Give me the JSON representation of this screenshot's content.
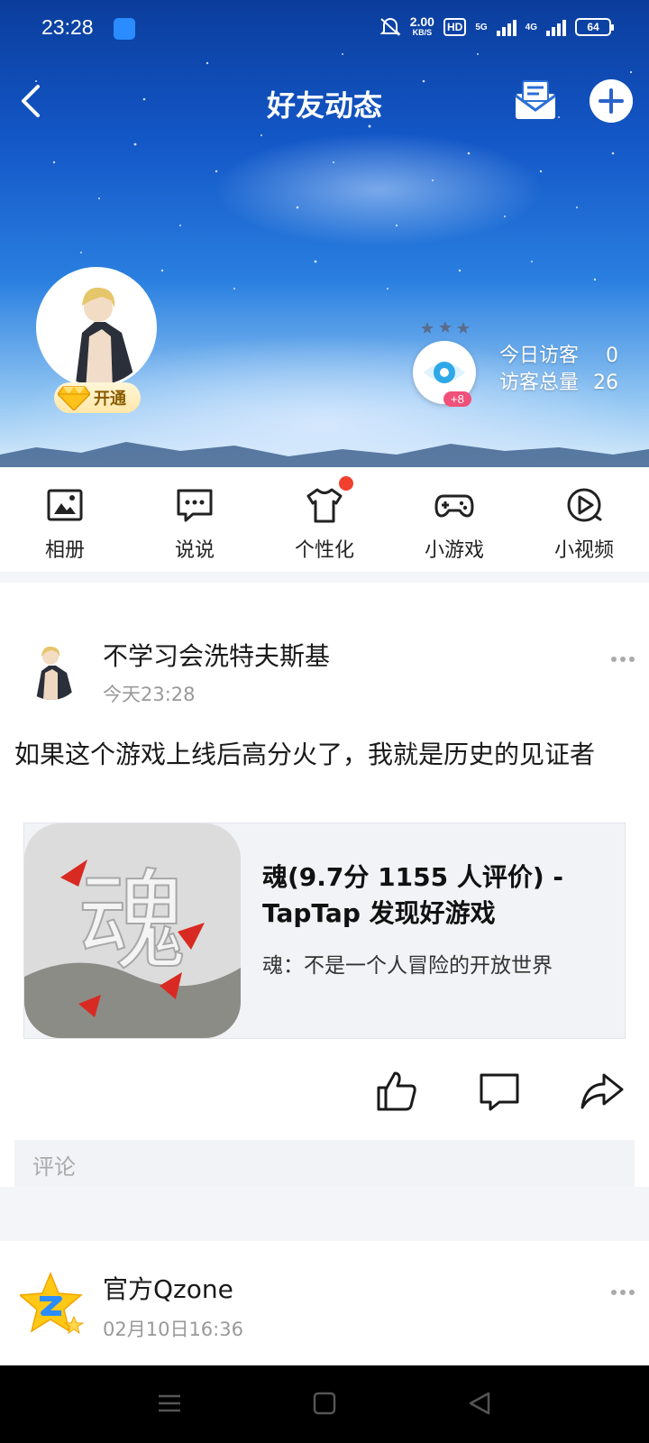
{
  "status_bar": {
    "time": "23:28",
    "net_speed": "2.00",
    "net_speed_unit": "KB/S",
    "hd_label": "HD",
    "signal_1": "5G",
    "signal_2": "4G",
    "battery": "64"
  },
  "header": {
    "title": "好友动态"
  },
  "visitors": {
    "today_label": "今日访客",
    "today_value": "0",
    "total_label": "访客总量",
    "total_value": "26",
    "plus_badge": "+8"
  },
  "vip": {
    "label": "开通"
  },
  "shortcuts": [
    {
      "label": "相册"
    },
    {
      "label": "说说"
    },
    {
      "label": "个性化"
    },
    {
      "label": "小游戏"
    },
    {
      "label": "小视频"
    }
  ],
  "post": {
    "author": "不学习会洗特夫斯基",
    "time": "今天23:28",
    "text": "如果这个游戏上线后高分火了，我就是历史的见证者",
    "card": {
      "thumb_char": "魂",
      "title": "魂(9.7分 1155 人评价) - TapTap 发现好游戏",
      "desc": "魂：不是一个人冒险的开放世界"
    },
    "comment_placeholder": "评论"
  },
  "post2": {
    "author": "官方Qzone",
    "time": "02月10日16:36"
  },
  "colors": {
    "accent_red": "#f1402e",
    "badge_pink": "#f0507a"
  }
}
